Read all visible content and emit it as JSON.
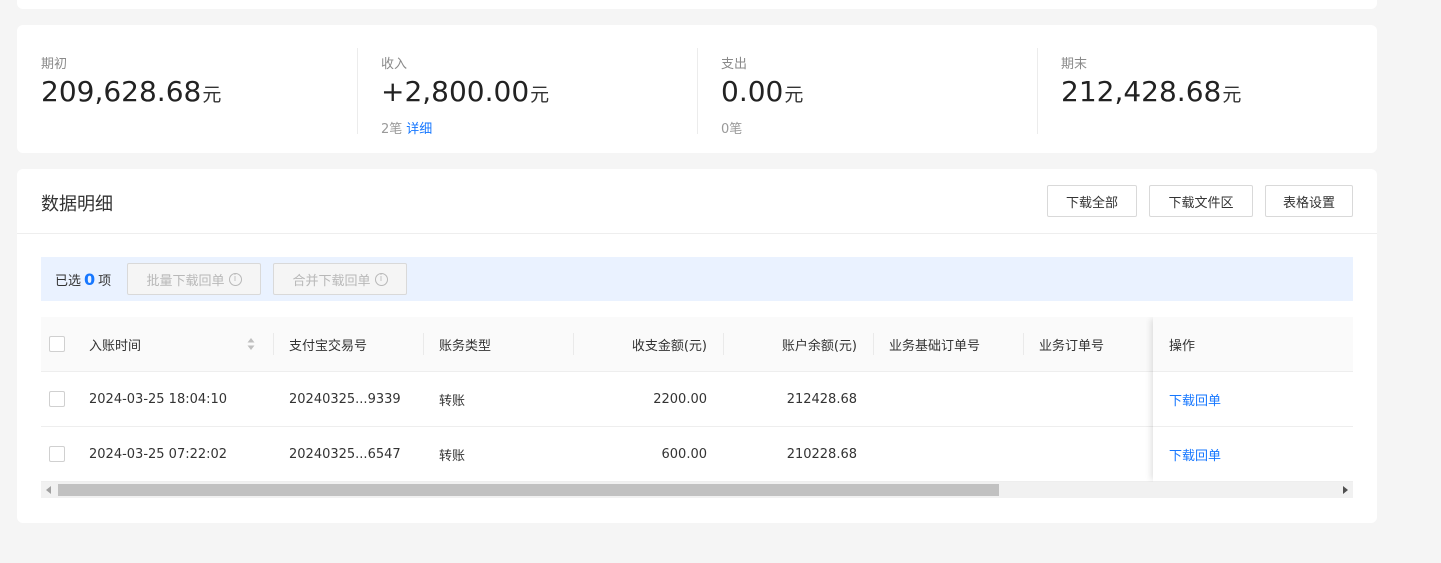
{
  "summary": {
    "opening": {
      "label": "期初",
      "value": "209,628.68",
      "unit": "元"
    },
    "income": {
      "label": "收入",
      "value": "+2,800.00",
      "unit": "元",
      "count": "2笔",
      "detail_link": "详细"
    },
    "expense": {
      "label": "支出",
      "value": "0.00",
      "unit": "元",
      "count": "0笔"
    },
    "closing": {
      "label": "期末",
      "value": "212,428.68",
      "unit": "元"
    }
  },
  "detail": {
    "title": "数据明细",
    "buttons": {
      "download_all": "下载全部",
      "download_area": "下载文件区",
      "table_settings": "表格设置"
    },
    "selection": {
      "prefix": "已选",
      "count": "0",
      "suffix": "项",
      "batch_download": "批量下载回单",
      "merge_download": "合并下载回单"
    },
    "columns": {
      "time": "入账时间",
      "alipay_no": "支付宝交易号",
      "type": "账务类型",
      "amount": "收支金额(元)",
      "balance": "账户余额(元)",
      "base_order": "业务基础订单号",
      "order": "业务订单号",
      "action": "操作"
    },
    "rows": [
      {
        "time": "2024-03-25 18:04:10",
        "alipay_no": "20240325...9339",
        "type": "转账",
        "amount": "2200.00",
        "balance": "212428.68",
        "base_order": "",
        "order": "",
        "action": "下载回单"
      },
      {
        "time": "2024-03-25 07:22:02",
        "alipay_no": "20240325...6547",
        "type": "转账",
        "amount": "600.00",
        "balance": "210228.68",
        "base_order": "",
        "order": "",
        "action": "下载回单"
      }
    ],
    "horizontal_scroll_fraction": 0.72
  },
  "icons": {
    "info": "info-icon",
    "sort": "sort-icon",
    "scroll_left": "scroll-left-arrow-icon",
    "scroll_right": "scroll-right-arrow-icon"
  },
  "colors": {
    "link": "#1677ff",
    "selection_bg": "#eaf2ff",
    "page_bg": "#f5f5f5"
  }
}
